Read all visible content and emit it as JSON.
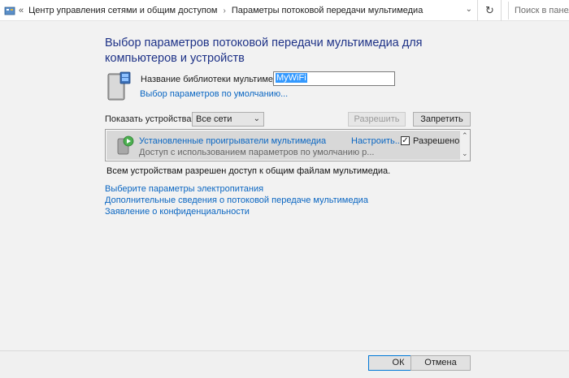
{
  "address_bar": {
    "back_chevrons": "«",
    "breadcrumb": [
      "Центр управления сетями и общим доступом",
      "Параметры потоковой передачи мультимедиа"
    ],
    "refresh_icon": "refresh-icon",
    "search_placeholder": "Поиск в панели"
  },
  "page": {
    "title": "Выбор параметров потоковой передачи мультимедиа для компьютеров и устройств",
    "library_label": "Название библиотеки мультимедиа:",
    "library_value": "MyWiFi",
    "default_link": "Выбор параметров по умолчанию...",
    "show_devices_label": "Показать устройства на:",
    "network_select": "Все сети",
    "allow_all": "Разрешить все",
    "deny_all": "Запретить все",
    "devices": [
      {
        "title": "Установленные проигрыватели мультимедиа",
        "subtitle": "Доступ с использованием параметров по умолчанию р...",
        "configure": "Настроить...",
        "checked": "✓",
        "status": "Разрешено"
      }
    ],
    "summary": "Всем устройствам разрешен доступ к общим файлам мультимедиа.",
    "links": [
      "Выберите параметры электропитания",
      "Дополнительные сведения о потоковой передаче мультимедиа",
      "Заявление о конфиденциальности"
    ]
  },
  "footer": {
    "ok": "ОК",
    "cancel": "Отмена"
  },
  "colors": {
    "title": "#1e3287",
    "link": "#0a66c2",
    "selection": "#3399ff"
  }
}
